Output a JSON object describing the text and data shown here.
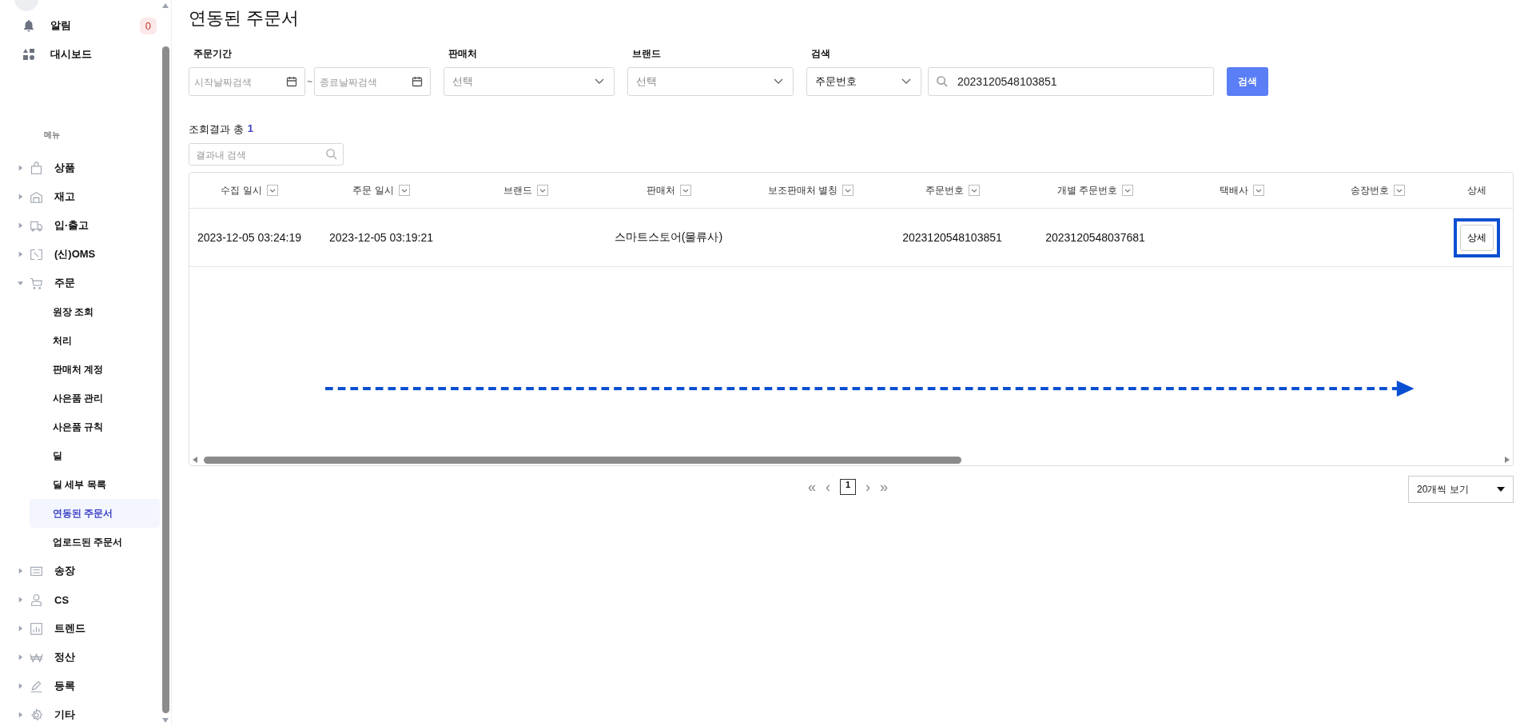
{
  "sidebar": {
    "notification": {
      "label": "알림",
      "count": "0"
    },
    "dashboard": {
      "label": "대시보드"
    },
    "menu_heading": "메뉴",
    "items": [
      {
        "label": "상품",
        "expanded": false
      },
      {
        "label": "재고",
        "expanded": false
      },
      {
        "label": "입·출고",
        "expanded": false
      },
      {
        "label": "(신)OMS",
        "expanded": false
      },
      {
        "label": "주문",
        "expanded": true,
        "children": [
          {
            "label": "원장 조회",
            "selected": false
          },
          {
            "label": "처리",
            "selected": false
          },
          {
            "label": "판매처 계정",
            "selected": false
          },
          {
            "label": "사은품 관리",
            "selected": false
          },
          {
            "label": "사은품 규칙",
            "selected": false
          },
          {
            "label": "딜",
            "selected": false
          },
          {
            "label": "딜 세부 목록",
            "selected": false
          },
          {
            "label": "연동된 주문서",
            "selected": true
          },
          {
            "label": "업로드된 주문서",
            "selected": false
          }
        ]
      },
      {
        "label": "송장",
        "expanded": false
      },
      {
        "label": "CS",
        "expanded": false
      },
      {
        "label": "트렌드",
        "expanded": false
      },
      {
        "label": "정산",
        "expanded": false
      },
      {
        "label": "등록",
        "expanded": false
      },
      {
        "label": "기타",
        "expanded": false
      }
    ]
  },
  "page_title": "연동된 주문서",
  "filters": {
    "period": {
      "label": "주문기간",
      "start_placeholder": "시작날짜검색",
      "separator": "~",
      "end_placeholder": "종료날짜검색"
    },
    "seller": {
      "label": "판매처",
      "placeholder": "선택"
    },
    "brand": {
      "label": "브랜드",
      "placeholder": "선택"
    },
    "search": {
      "label": "검색",
      "type": "주문번호",
      "value": "2023120548103851"
    },
    "search_button": "검색"
  },
  "results": {
    "label": "조회결과 총",
    "count": "1",
    "filter_placeholder": "결과내 검색"
  },
  "table": {
    "columns": [
      "수집 일시",
      "주문 일시",
      "브랜드",
      "판매처",
      "보조판매처 별칭",
      "주문번호",
      "개별 주문번호",
      "택배사",
      "송장번호",
      "상세"
    ],
    "rows": [
      {
        "cells": [
          "2023-12-05 03:24:19",
          "2023-12-05 03:19:21",
          "",
          "스마트스토어(물류사)",
          "",
          "2023120548103851",
          "2023120548037681",
          "",
          ""
        ],
        "detail_button": "상세"
      }
    ]
  },
  "pagination": {
    "first": "«",
    "prev": "‹",
    "pages": [
      {
        "label": "1",
        "selected": true
      }
    ],
    "next": "›",
    "last": "»",
    "page_size": "20개씩 보기"
  }
}
